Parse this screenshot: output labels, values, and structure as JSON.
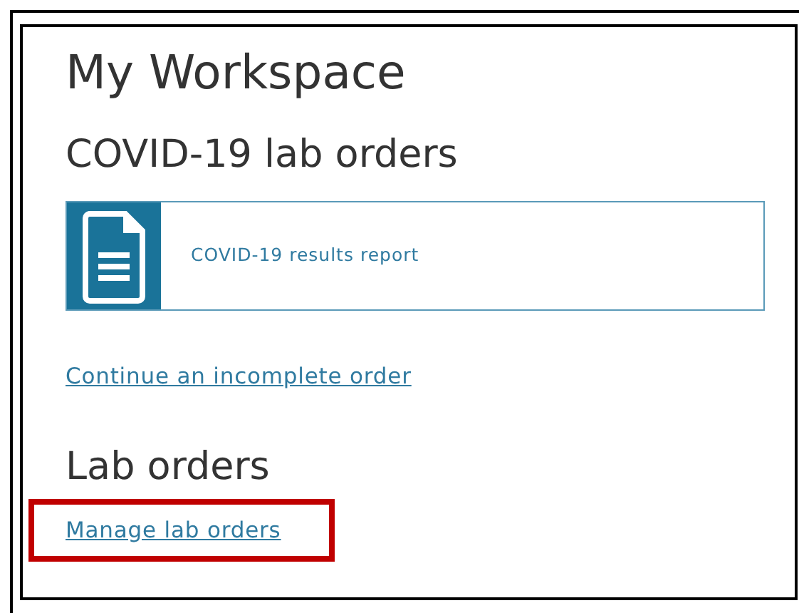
{
  "title": "My Workspace",
  "sections": [
    {
      "heading": "COVID-19 lab orders",
      "cards": [
        {
          "label": "COVID-19 results report"
        }
      ],
      "links": [
        {
          "label": "Continue an incomplete order",
          "highlighted": false
        }
      ]
    },
    {
      "heading": "Lab orders",
      "links": [
        {
          "label": "Manage lab orders",
          "highlighted": true
        }
      ]
    }
  ]
}
